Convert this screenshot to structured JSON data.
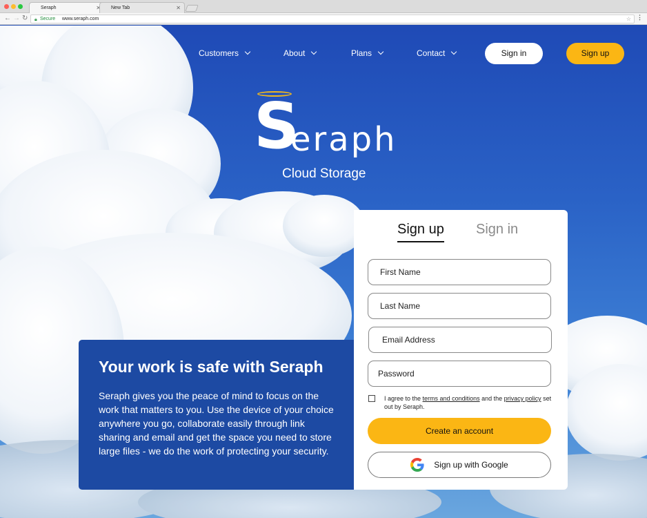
{
  "browser": {
    "tabs": [
      {
        "label": "Seraph",
        "active": true
      },
      {
        "label": "New Tab",
        "active": false
      }
    ],
    "secure_label": "Secure",
    "url": "www.seraph.com"
  },
  "nav": {
    "items": [
      "Customers",
      "About",
      "Plans",
      "Contact"
    ],
    "signin_label": "Sign in",
    "signup_label": "Sign up"
  },
  "logo": {
    "initial": "S",
    "rest": "eraph",
    "tagline": "Cloud Storage"
  },
  "info": {
    "heading": "Your work is safe with Seraph",
    "body": "Seraph gives you the peace of mind to focus on the work that matters to you. Use the device of your choice anywhere you go, collaborate easily through link sharing and email and get the space you need to store large files - we do the work of protecting your security."
  },
  "form": {
    "tab_signup": "Sign up",
    "tab_signin": "Sign in",
    "first_name_placeholder": "First Name",
    "last_name_placeholder": "Last Name",
    "email_placeholder": "Email Address",
    "password_placeholder": "Password",
    "agree_prefix": "I agree to the ",
    "terms_link": "terms and conditions",
    "agree_mid": " and the ",
    "privacy_link": "privacy policy",
    "agree_suffix": " set out by Seraph.",
    "checkbox_checked": false,
    "create_label": "Create an account",
    "google_label": "Sign up with Google"
  },
  "colors": {
    "accent": "#fbb614",
    "panel": "#1d4aa3",
    "sky": "#1f4ab6"
  }
}
